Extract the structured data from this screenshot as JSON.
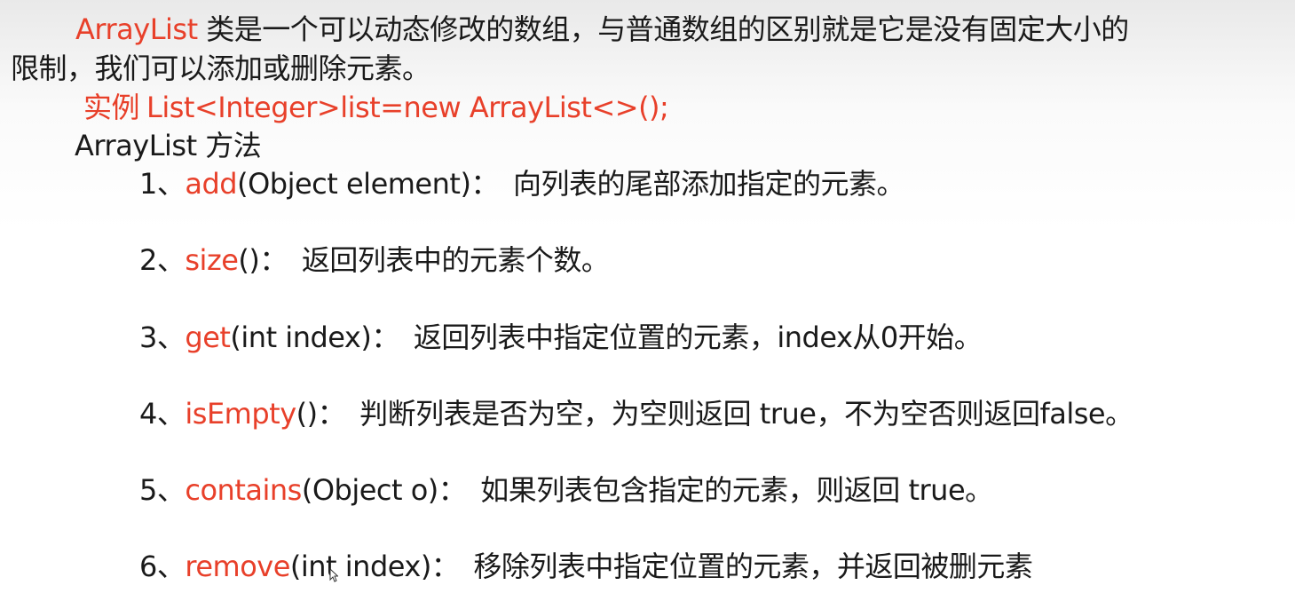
{
  "intro": {
    "term": "ArrayList",
    "line1_rest": " 类是一个可以动态修改的数组，与普通数组的区别就是它是没有固定大小的",
    "line2": "限制，我们可以添加或删除元素。"
  },
  "example": {
    "label": "实例",
    "code": "List<Integer>list=new ArrayList<>();"
  },
  "methods_heading": "ArrayList 方法",
  "methods": [
    {
      "num": "1、",
      "name": "add",
      "params": "(Object element)：",
      "desc": "向列表的尾部添加指定的元素。"
    },
    {
      "num": "2、",
      "name": "size",
      "params": "()：",
      "desc": "返回列表中的元素个数。"
    },
    {
      "num": "3、",
      "name": "get",
      "params": "(int index)：",
      "desc": "返回列表中指定位置的元素，index从0开始。"
    },
    {
      "num": "4、",
      "name": "isEmpty",
      "params": "()：",
      "desc": "判断列表是否为空，为空则返回 true，不为空否则返回false。"
    },
    {
      "num": "5、",
      "name": "contains",
      "params": "(Object o)：",
      "desc": "如果列表包含指定的元素，则返回 true。"
    },
    {
      "num": "6、",
      "name": "remove",
      "params": "(int index)：",
      "desc": "移除列表中指定位置的元素，并返回被删元素"
    }
  ],
  "colors": {
    "accent_red": "#e8402a",
    "text": "#1a1a1a"
  },
  "icons": {
    "cursor": "mouse-pointer-icon"
  }
}
